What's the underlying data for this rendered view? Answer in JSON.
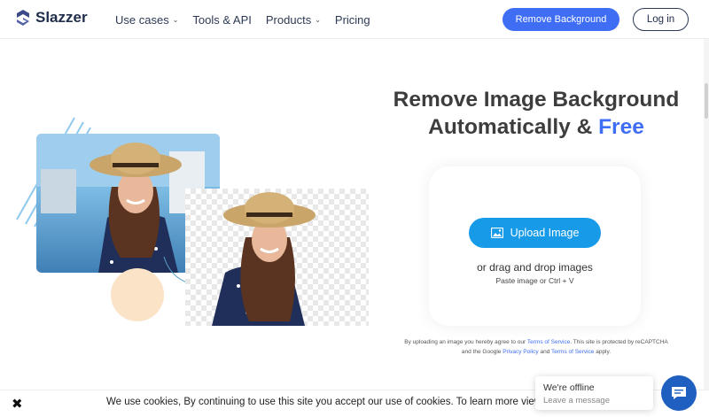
{
  "header": {
    "brand": "Slazzer",
    "nav": [
      {
        "label": "Use cases",
        "dropdown": true
      },
      {
        "label": "Tools & API",
        "dropdown": false
      },
      {
        "label": "Products",
        "dropdown": true
      },
      {
        "label": "Pricing",
        "dropdown": false
      }
    ],
    "cta_label": "Remove Background",
    "login_label": "Log in"
  },
  "hero": {
    "title_line1": "Remove Image Background",
    "title_line2_prefix": "Automatically & ",
    "title_line2_accent": "Free",
    "upload_label": "Upload Image",
    "drag_text": "or drag and drop images",
    "paste_text": "Paste image or Ctrl + V",
    "legal": {
      "part1": "By uploading an image you hereby agree to our ",
      "terms_link": "Terms of Service",
      "part2": ". This site is protected by reCAPTCHA and the Google ",
      "privacy_link": "Privacy Policy",
      "part3": " and ",
      "terms_link2": "Terms of Service",
      "part4": " apply."
    }
  },
  "cookie": {
    "text": "We use cookies,  By continuing to use this site you accept our use of cookies. To learn more view c"
  },
  "chat": {
    "status": "We're offline",
    "placeholder": "Leave a message"
  },
  "colors": {
    "accent": "#3f6ef5",
    "upload_button": "#179be8",
    "chat_button": "#1f5fbf",
    "peach": "#fbe3c8"
  }
}
